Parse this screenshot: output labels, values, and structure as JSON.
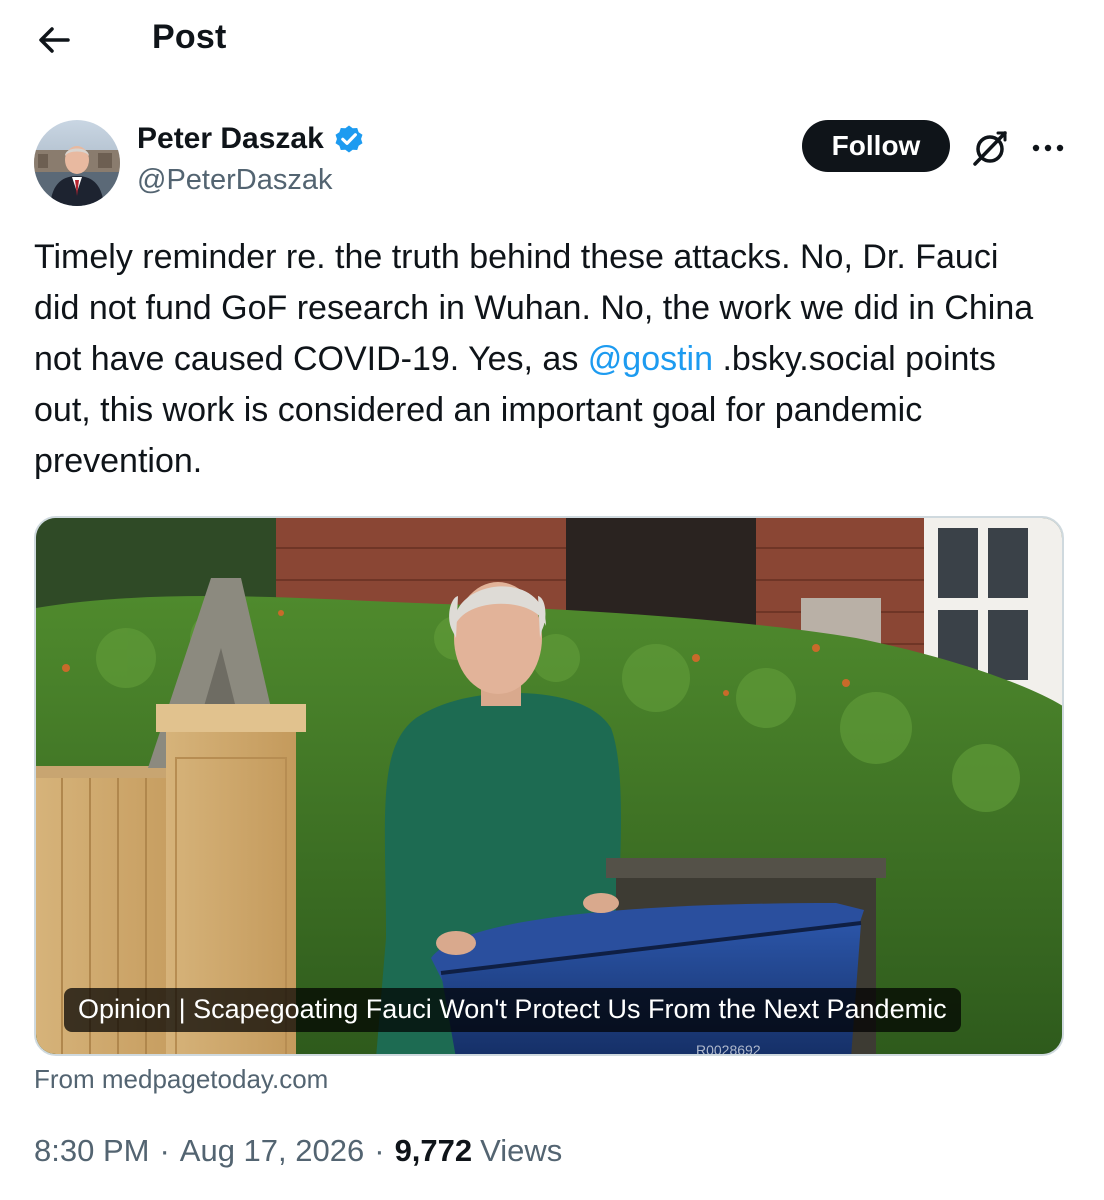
{
  "header": {
    "title": "Post",
    "back_icon": "arrow-left-icon"
  },
  "author": {
    "name": "Peter Daszak",
    "handle": "@PeterDaszak",
    "verified": true,
    "verified_color": "#1d9bf0"
  },
  "actions": {
    "follow_label": "Follow",
    "grok_icon": "grok-icon",
    "more_icon": "more-horizontal-icon"
  },
  "tweet": {
    "text_part1": "Timely reminder re. the truth behind these attacks. No, Dr. Fauci did not fund GoF research in Wuhan. No, the work we did in China not have caused COVID-19. Yes, as ",
    "mention": "@gostin",
    "text_part2": " .bsky.social points out, this work is considered an important goal for pandemic prevention."
  },
  "card": {
    "caption": "Opinion | Scapegoating Fauci Won't Protect Us From the Next Pandemic",
    "source": "From medpagetoday.com",
    "bin_label": "R0028692"
  },
  "meta": {
    "time": "8:30 PM",
    "date": "Aug 17, 2026",
    "separator": "·",
    "views_count": "9,772",
    "views_label": "Views"
  },
  "colors": {
    "text_primary": "#0f1419",
    "text_secondary": "#536471",
    "link": "#1d9bf0",
    "border": "#cfd9de"
  }
}
